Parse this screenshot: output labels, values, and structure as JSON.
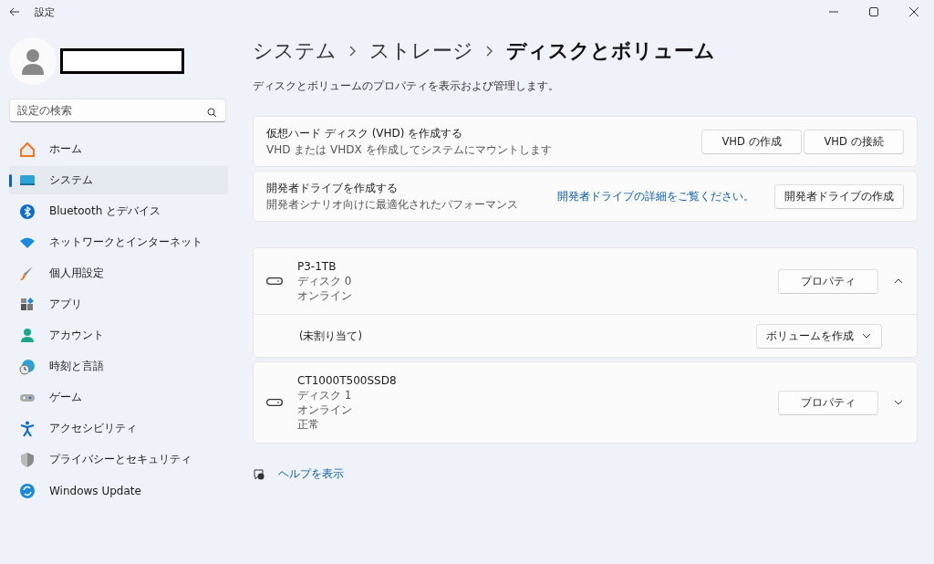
{
  "window": {
    "title": "設定"
  },
  "search": {
    "placeholder": "設定の検索"
  },
  "sidebar": {
    "items": [
      {
        "label": "ホーム",
        "selected": false
      },
      {
        "label": "システム",
        "selected": true
      },
      {
        "label": "Bluetooth とデバイス",
        "selected": false
      },
      {
        "label": "ネットワークとインターネット",
        "selected": false
      },
      {
        "label": "個人用設定",
        "selected": false
      },
      {
        "label": "アプリ",
        "selected": false
      },
      {
        "label": "アカウント",
        "selected": false
      },
      {
        "label": "時刻と言語",
        "selected": false
      },
      {
        "label": "ゲーム",
        "selected": false
      },
      {
        "label": "アクセシビリティ",
        "selected": false
      },
      {
        "label": "プライバシーとセキュリティ",
        "selected": false
      },
      {
        "label": "Windows Update",
        "selected": false
      }
    ]
  },
  "breadcrumb": [
    "システム",
    "ストレージ",
    "ディスクとボリューム"
  ],
  "description": "ディスクとボリュームのプロパティを表示および管理します。",
  "cards": [
    {
      "title": "仮想ハード ディスク (VHD) を作成する",
      "subtitle": "VHD または VHDX を作成してシステムにマウントします",
      "buttons": [
        "VHD の作成",
        "VHD の接続"
      ]
    },
    {
      "title": "開発者ドライブを作成する",
      "subtitle": "開発者シナリオ向けに最適化されたパフォーマンス",
      "link": "開発者ドライブの詳細をご覧ください。",
      "buttons": [
        "開発者ドライブの作成"
      ]
    }
  ],
  "disks": [
    {
      "name": "P3-1TB",
      "lines": [
        "ディスク 0",
        "オンライン"
      ],
      "button": "プロパティ",
      "expanded": true,
      "volumes": [
        {
          "label": "(未割り当て)",
          "button": "ボリュームを作成"
        }
      ]
    },
    {
      "name": "CT1000T500SSD8",
      "lines": [
        "ディスク 1",
        "オンライン",
        "正常"
      ],
      "button": "プロパティ",
      "expanded": false
    }
  ],
  "help": {
    "link": "ヘルプを表示"
  }
}
